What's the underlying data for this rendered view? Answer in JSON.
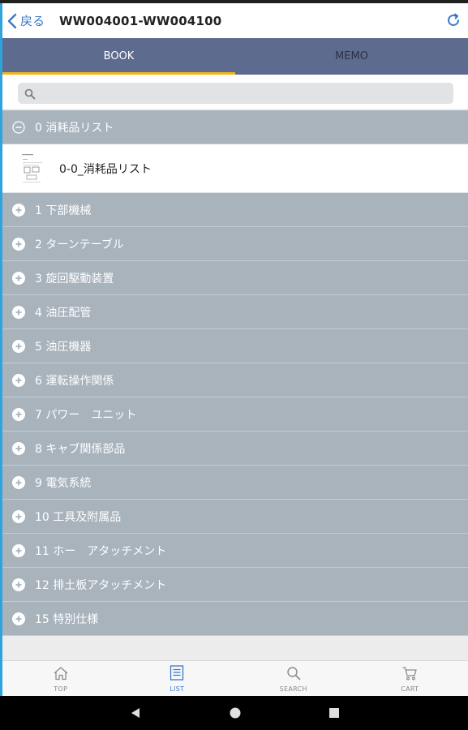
{
  "header": {
    "back_label": "戻る",
    "title": "WW004001-WW004100"
  },
  "tabs": [
    {
      "label": "BOOK",
      "active": true
    },
    {
      "label": "MEMO",
      "active": false
    }
  ],
  "search": {
    "placeholder": "",
    "value": ""
  },
  "sections": [
    {
      "label": "0 消耗品リスト",
      "expanded": true,
      "items": [
        {
          "label": "0-0_消耗品リスト"
        }
      ]
    },
    {
      "label": "1 下部機械",
      "expanded": false
    },
    {
      "label": "2 ターンテーブル",
      "expanded": false
    },
    {
      "label": "3 旋回駆動装置",
      "expanded": false
    },
    {
      "label": "4 油圧配管",
      "expanded": false
    },
    {
      "label": "5 油圧機器",
      "expanded": false
    },
    {
      "label": "6 運転操作関係",
      "expanded": false
    },
    {
      "label": "7 パワー　ユニット",
      "expanded": false
    },
    {
      "label": "8 キャブ関係部品",
      "expanded": false
    },
    {
      "label": "9 電気系統",
      "expanded": false
    },
    {
      "label": "10 工具及附属品",
      "expanded": false
    },
    {
      "label": "11 ホー　アタッチメント",
      "expanded": false
    },
    {
      "label": "12 排土板アタッチメント",
      "expanded": false
    },
    {
      "label": "15 特別仕様",
      "expanded": false
    }
  ],
  "bottom_nav": [
    {
      "label": "TOP",
      "icon": "home-icon"
    },
    {
      "label": "LIST",
      "icon": "list-icon",
      "active": true
    },
    {
      "label": "SEARCH",
      "icon": "search-icon"
    },
    {
      "label": "CART",
      "icon": "cart-icon"
    }
  ],
  "colors": {
    "accent": "#3b79c6",
    "tab_bar": "#5d6b8f",
    "tab_indicator": "#f4b51c",
    "section_row": "#a8b3bc"
  }
}
